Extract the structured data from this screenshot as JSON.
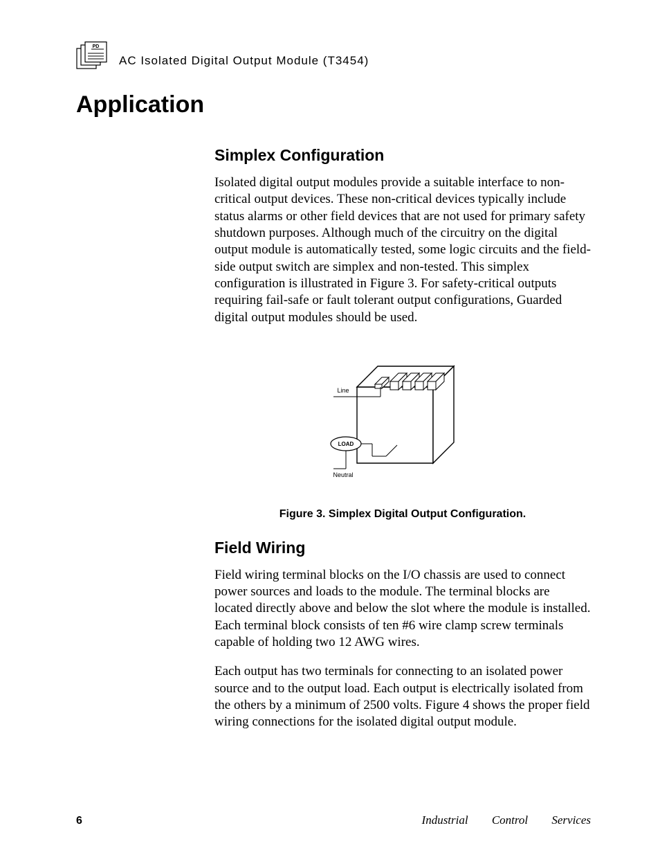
{
  "header": {
    "icon_label": "PD",
    "running_title": "AC  Isolated  Digital  Output  Module (T3454)"
  },
  "section": {
    "title": "Application"
  },
  "simplex": {
    "heading": "Simplex Configuration",
    "body": "Isolated digital output modules provide a suitable interface to non-critical output devices.  These non-critical devices typically include status alarms or other field devices that are not used for primary safety shutdown purposes.  Although much of the circuitry on the digital output module is automatically tested, some logic circuits and the field-side output switch are simplex and non-tested.  This simplex configuration is illustrated in Figure 3.  For safety-critical outputs requiring fail-safe or fault tolerant output configurations, Guarded digital output modules should be used."
  },
  "figure": {
    "labels": {
      "line": "Line",
      "load": "LOAD",
      "neutral": "Neutral"
    },
    "caption": "Figure 3.  Simplex Digital Output Configuration."
  },
  "field_wiring": {
    "heading": "Field Wiring",
    "p1": "Field wiring terminal blocks on the I/O chassis are used to connect power sources and loads to the module.  The terminal blocks are located directly above and below the slot where the module is installed.  Each terminal block consists of ten #6 wire clamp screw terminals capable of holding two 12 AWG wires.",
    "p2": "Each output has two terminals for connecting to an isolated power source and to the output load.  Each output is electrically isolated from the others by a minimum of 2500 volts.  Figure 4 shows the proper field wiring connections for the isolated digital output module."
  },
  "footer": {
    "page_number": "6",
    "text": "Industrial Control Services"
  }
}
